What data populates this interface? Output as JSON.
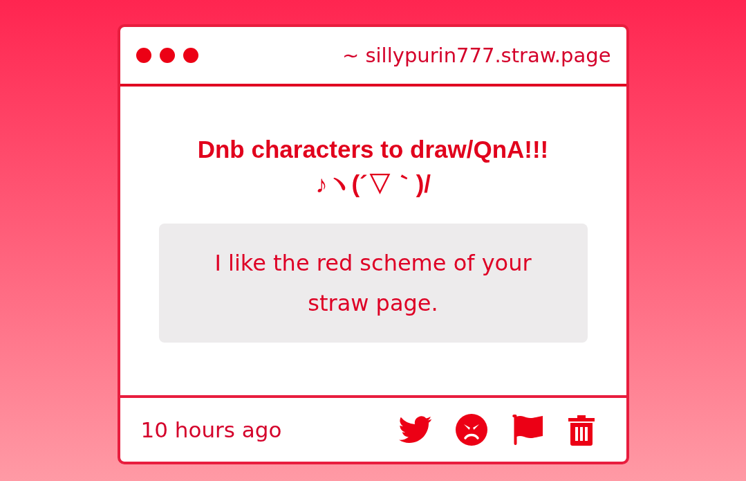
{
  "window": {
    "url": "~ sillypurin777.straw.page"
  },
  "question": {
    "title_lines": [
      "Dnb characters to draw/QnA!!!",
      "♪ヽ(´▽｀)/"
    ]
  },
  "answer": {
    "text": "I like the red scheme of your straw page."
  },
  "footer": {
    "time": "10 hours ago"
  }
}
